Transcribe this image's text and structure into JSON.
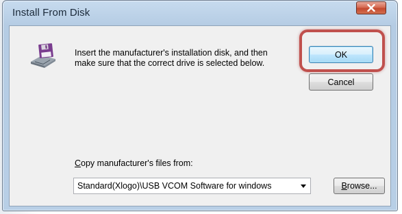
{
  "window": {
    "title": "Install From Disk",
    "close_glyph": "✕"
  },
  "message": {
    "line1": "Insert the manufacturer's installation disk, and then",
    "line2": "make sure that the correct drive is selected below."
  },
  "buttons": {
    "ok_label": "OK",
    "cancel_label": "Cancel",
    "browse_label_underlined": "B",
    "browse_label_rest": "rowse..."
  },
  "copy_from": {
    "label_underlined": "C",
    "label_rest": "opy manufacturer's files from:",
    "selected_value": "Standard(Xlogo)\\USB VCOM Software for windows"
  },
  "icons": {
    "disk": "floppy-disk-drive-icon",
    "close": "close-icon",
    "dropdown": "chevron-down-icon"
  },
  "colors": {
    "highlight": "#c0504d",
    "close_button": "#c4482f",
    "title_bar": "#b5cce4",
    "dialog_body": "#f0f0f0"
  }
}
